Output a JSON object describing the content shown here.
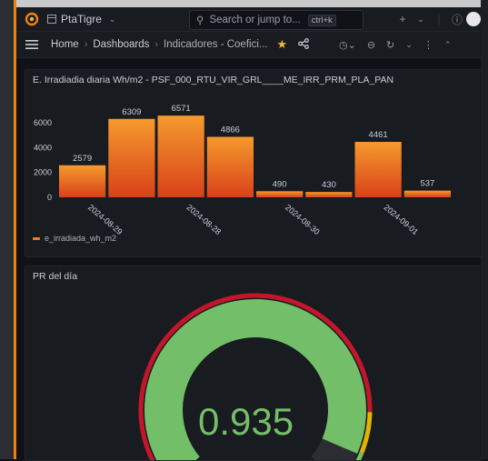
{
  "app": {
    "org_name": "PtaTigre"
  },
  "search": {
    "placeholder": "Search or jump to...",
    "shortcut": "ctrl+k"
  },
  "nav": {
    "breadcrumbs": [
      "Home",
      "Dashboards",
      "Indicadores - Coefici..."
    ]
  },
  "panel_irradiation": {
    "title": "E. Irradiadia diaria Wh/m2 - PSF_000_RTU_VIR_GRL____ME_IRR_PRM_PLA_PAN",
    "legend": "e_irradiada_wh_m2",
    "y_ticks": [
      "0",
      "2000",
      "4000",
      "6000"
    ]
  },
  "chart_data": {
    "type": "bar",
    "categories": [
      "b1",
      "b2",
      "b3",
      "b4",
      "b5",
      "b6",
      "b7",
      "b8"
    ],
    "values": [
      2579,
      6309,
      6571,
      4866,
      490,
      430,
      4461,
      537
    ],
    "value_labels": [
      "2579",
      "6309",
      "6571",
      "4866",
      "490",
      "430",
      "4461",
      "537"
    ],
    "x_tick_labels": [
      "2024-08-29",
      "2024-08-28",
      "2024-08-30",
      "2024-09-01"
    ],
    "x_tick_after_bar": [
      0,
      2,
      4,
      6
    ],
    "ylim": [
      0,
      7000
    ],
    "bar_colors": {
      "top": "#f59a2d",
      "bottom": "#d9411a"
    },
    "legend": [
      "e_irradiada_wh_m2"
    ]
  },
  "panel_pr": {
    "title": "PR del día",
    "value": "0.935",
    "fraction": 0.935,
    "colors": {
      "value": "#73bf69",
      "red": "#c4162a",
      "yellow": "#e0b400",
      "bg": "#2b2d33"
    }
  }
}
